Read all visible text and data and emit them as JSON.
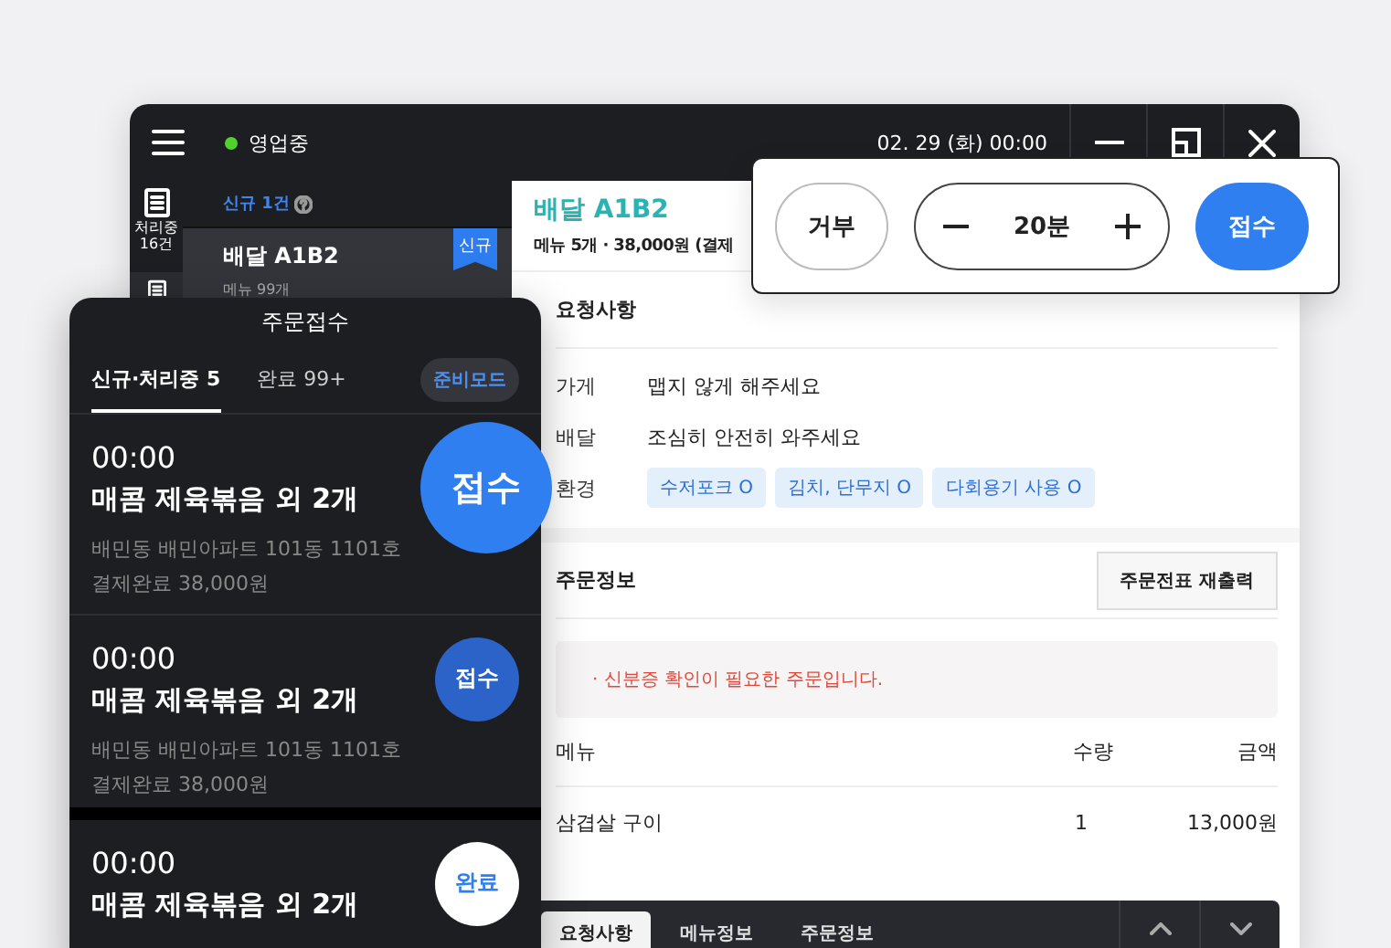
{
  "header": {
    "status": "영업중",
    "online": true,
    "datetime": "02. 29 (화) 00:00"
  },
  "rail": [
    {
      "label": "처리중\n16건",
      "selected": true
    },
    {
      "selected": false
    }
  ],
  "list": {
    "heading": "신규 1건",
    "items": [
      {
        "title": "배달 A1B2",
        "sub": "메뉴 99개",
        "badge": "신규",
        "selected": true
      }
    ]
  },
  "detail": {
    "title": "배달 A1B2",
    "summary": "메뉴 5개 · 38,000원 (결제",
    "requests_title": "요청사항",
    "requests": [
      {
        "label": "가게",
        "value": "맵지 않게 해주세요"
      },
      {
        "label": "배달",
        "value": "조심히 안전히 와주세요"
      },
      {
        "label": "환경",
        "tags": [
          "수저포크 O",
          "김치, 단무지 O",
          "다회용기 사용 O"
        ]
      }
    ],
    "order_title": "주문정보",
    "reprint": "주문전표 재출력",
    "notice": "· 신분증 확인이 필요한 주문입니다.",
    "columns": [
      "메뉴",
      "수량",
      "금액"
    ],
    "rows": [
      {
        "menu": "삼겹살 구이",
        "qty": "1",
        "price": "13,000원"
      }
    ]
  },
  "bottom_tabs": [
    {
      "label": "요청사항",
      "selected": true
    },
    {
      "label": "메뉴정보",
      "selected": false
    },
    {
      "label": "주문정보",
      "selected": false
    }
  ],
  "popup": {
    "reject": "거부",
    "time": "20분",
    "accept": "접수"
  },
  "panel": {
    "title": "주문접수",
    "tabs": [
      {
        "label": "신규·처리중 5",
        "selected": true
      },
      {
        "label": "완료 99+",
        "selected": false
      }
    ],
    "mode": "준비모드",
    "orders": [
      {
        "time": "00:00",
        "title": "매콤 제육볶음 외 2개",
        "address": "배민동 배민아파트 101동 1101호",
        "payment": "결제완료 38,000원",
        "action": "접수",
        "kind": "accept-large"
      },
      {
        "time": "00:00",
        "title": "매콤 제육볶음 외 2개",
        "address": "배민동 배민아파트 101동 1101호",
        "payment": "결제완료 38,000원",
        "action": "접수",
        "kind": "accept"
      },
      {
        "time": "00:00",
        "title": "매콤 제육볶음 외 2개",
        "action": "완료",
        "kind": "done"
      }
    ]
  }
}
